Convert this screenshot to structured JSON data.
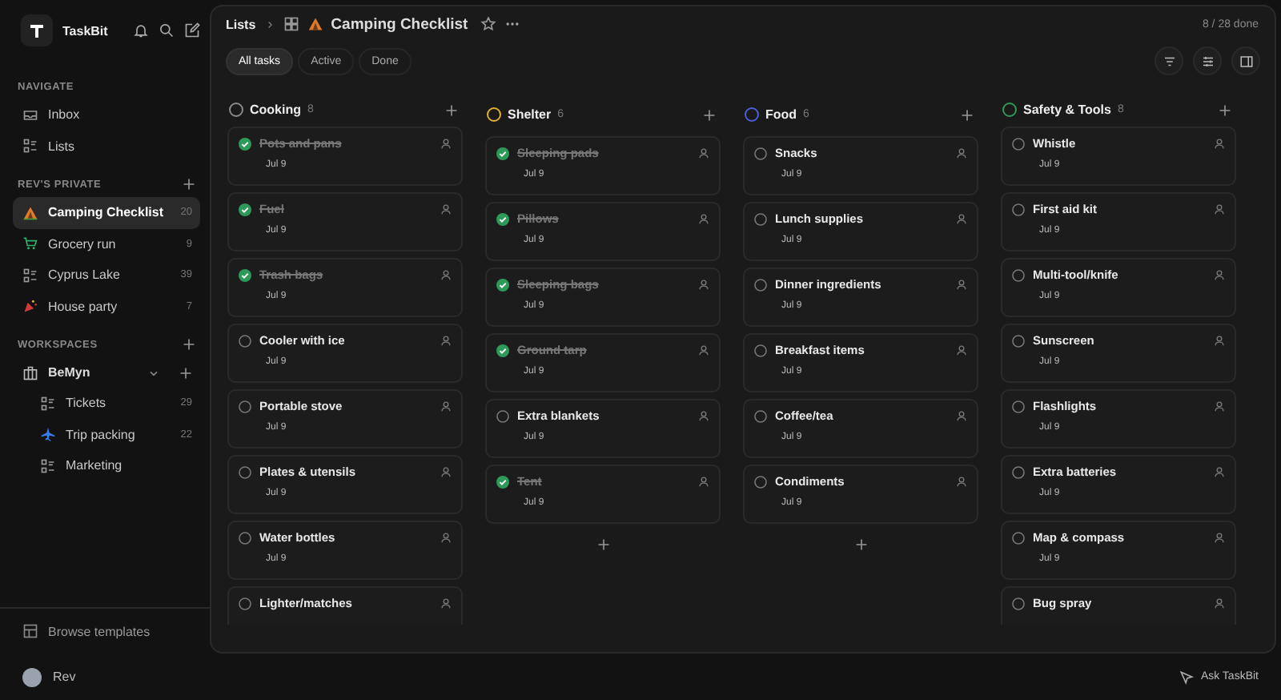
{
  "app": {
    "name": "TaskBit"
  },
  "sidebar": {
    "sections": [
      {
        "title": "NAVIGATE",
        "addable": false,
        "items": [
          {
            "label": "Inbox",
            "kind": "inbox",
            "selected": false
          },
          {
            "label": "Lists",
            "kind": "lists",
            "selected": false
          }
        ]
      },
      {
        "title": "REV'S PRIVATE",
        "addable": true,
        "items": [
          {
            "label": "Camping Checklist",
            "kind": "tent",
            "count": "20",
            "selected": true
          },
          {
            "label": "Grocery run",
            "kind": "cart",
            "count": "9",
            "selected": false
          },
          {
            "label": "Cyprus Lake",
            "kind": "list",
            "count": "39",
            "selected": false
          },
          {
            "label": "House party",
            "kind": "party",
            "count": "7",
            "selected": false
          }
        ]
      },
      {
        "title": "WORKSPACES",
        "addable": true,
        "workspace": {
          "label": "BeMyn",
          "expanded": true,
          "items": [
            {
              "label": "Tickets",
              "kind": "list",
              "count": "29",
              "selected": false
            },
            {
              "label": "Trip packing",
              "kind": "plane",
              "count": "22",
              "selected": false
            },
            {
              "label": "Marketing",
              "kind": "list",
              "selected": false
            }
          ]
        }
      }
    ],
    "footer": "Browse templates"
  },
  "user": {
    "name": "Rev"
  },
  "assistant": "Ask TaskBit",
  "breadcrumb": {
    "parent": "Lists",
    "title": "Camping Checklist",
    "progress": "8 / 28 done"
  },
  "filters": [
    {
      "label": "All tasks",
      "selected": true
    },
    {
      "label": "Active",
      "selected": false
    },
    {
      "label": "Done",
      "selected": false
    }
  ],
  "columns": [
    {
      "name": "Cooking",
      "count": "8",
      "color": "#8a8a8a",
      "tasks": [
        {
          "title": "Pots and pans",
          "done": true,
          "date": "Jul 9"
        },
        {
          "title": "Fuel",
          "done": true,
          "date": "Jul 9"
        },
        {
          "title": "Trash bags",
          "done": true,
          "date": "Jul 9"
        },
        {
          "title": "Cooler with ice",
          "done": false,
          "date": "Jul 9"
        },
        {
          "title": "Portable stove",
          "done": false,
          "date": "Jul 9"
        },
        {
          "title": "Plates & utensils",
          "done": false,
          "date": "Jul 9"
        },
        {
          "title": "Water bottles",
          "done": false,
          "date": "Jul 9"
        },
        {
          "title": "Lighter/matches",
          "done": false
        }
      ]
    },
    {
      "name": "Shelter",
      "count": "6",
      "color": "#e0b030",
      "tasks": [
        {
          "title": "Sleeping pads",
          "done": true,
          "date": "Jul 9"
        },
        {
          "title": "Pillows",
          "done": true,
          "date": "Jul 9"
        },
        {
          "title": "Sleeping bags",
          "done": true,
          "date": "Jul 9"
        },
        {
          "title": "Ground tarp",
          "done": true,
          "date": "Jul 9"
        },
        {
          "title": "Extra blankets",
          "done": false,
          "date": "Jul 9"
        },
        {
          "title": "Tent",
          "done": true,
          "date": "Jul 9"
        }
      ]
    },
    {
      "name": "Food",
      "count": "6",
      "color": "#4a5fd8",
      "tasks": [
        {
          "title": "Snacks",
          "done": false,
          "date": "Jul 9"
        },
        {
          "title": "Lunch supplies",
          "done": false,
          "date": "Jul 9"
        },
        {
          "title": "Dinner ingredients",
          "done": false,
          "date": "Jul 9"
        },
        {
          "title": "Breakfast items",
          "done": false,
          "date": "Jul 9"
        },
        {
          "title": "Coffee/tea",
          "done": false,
          "date": "Jul 9"
        },
        {
          "title": "Condiments",
          "done": false,
          "date": "Jul 9"
        }
      ]
    },
    {
      "name": "Safety & Tools",
      "count": "8",
      "color": "#2e9a5a",
      "tasks": [
        {
          "title": "Whistle",
          "done": false,
          "date": "Jul 9"
        },
        {
          "title": "First aid kit",
          "done": false,
          "date": "Jul 9"
        },
        {
          "title": "Multi-tool/knife",
          "done": false,
          "date": "Jul 9"
        },
        {
          "title": "Sunscreen",
          "done": false,
          "date": "Jul 9"
        },
        {
          "title": "Flashlights",
          "done": false,
          "date": "Jul 9"
        },
        {
          "title": "Extra batteries",
          "done": false,
          "date": "Jul 9"
        },
        {
          "title": "Map & compass",
          "done": false,
          "date": "Jul 9"
        },
        {
          "title": "Bug spray",
          "done": false
        }
      ]
    }
  ]
}
